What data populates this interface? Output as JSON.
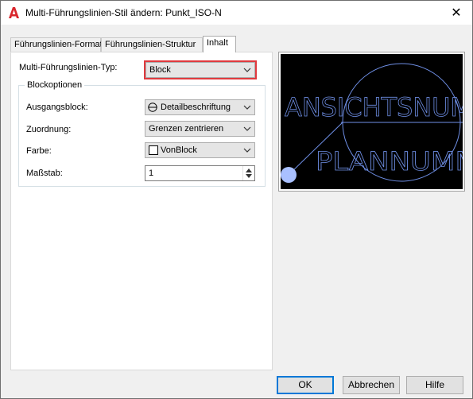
{
  "window": {
    "title": "Multi-Führungslinien-Stil ändern: Punkt_ISO-N",
    "close_glyph": "✕"
  },
  "tabs": [
    {
      "label": "Führungslinien-Format"
    },
    {
      "label": "Führungslinien-Struktur"
    },
    {
      "label": "Inhalt",
      "active": true
    }
  ],
  "content": {
    "mleader_type_label": "Multi-Führungslinien-Typ:",
    "mleader_type_value": "Block",
    "block_options_title": "Blockoptionen",
    "source_block_label": "Ausgangsblock:",
    "source_block_value": "Detailbeschriftung",
    "attachment_label": "Zuordnung:",
    "attachment_value": "Grenzen zentrieren",
    "color_label": "Farbe:",
    "color_value": "VonBlock",
    "scale_label": "Maßstab:",
    "scale_value": "1"
  },
  "preview": {
    "text_top": "ANSICHTSNUM",
    "text_bottom": "PLANNUMM",
    "line_color": "#6f8fe6",
    "background": "#000000"
  },
  "buttons": {
    "ok": "OK",
    "cancel": "Abbrechen",
    "help": "Hilfe"
  },
  "colors": {
    "highlight": "#e0393e",
    "accent": "#0078d7",
    "app_icon": "#d9262c"
  }
}
